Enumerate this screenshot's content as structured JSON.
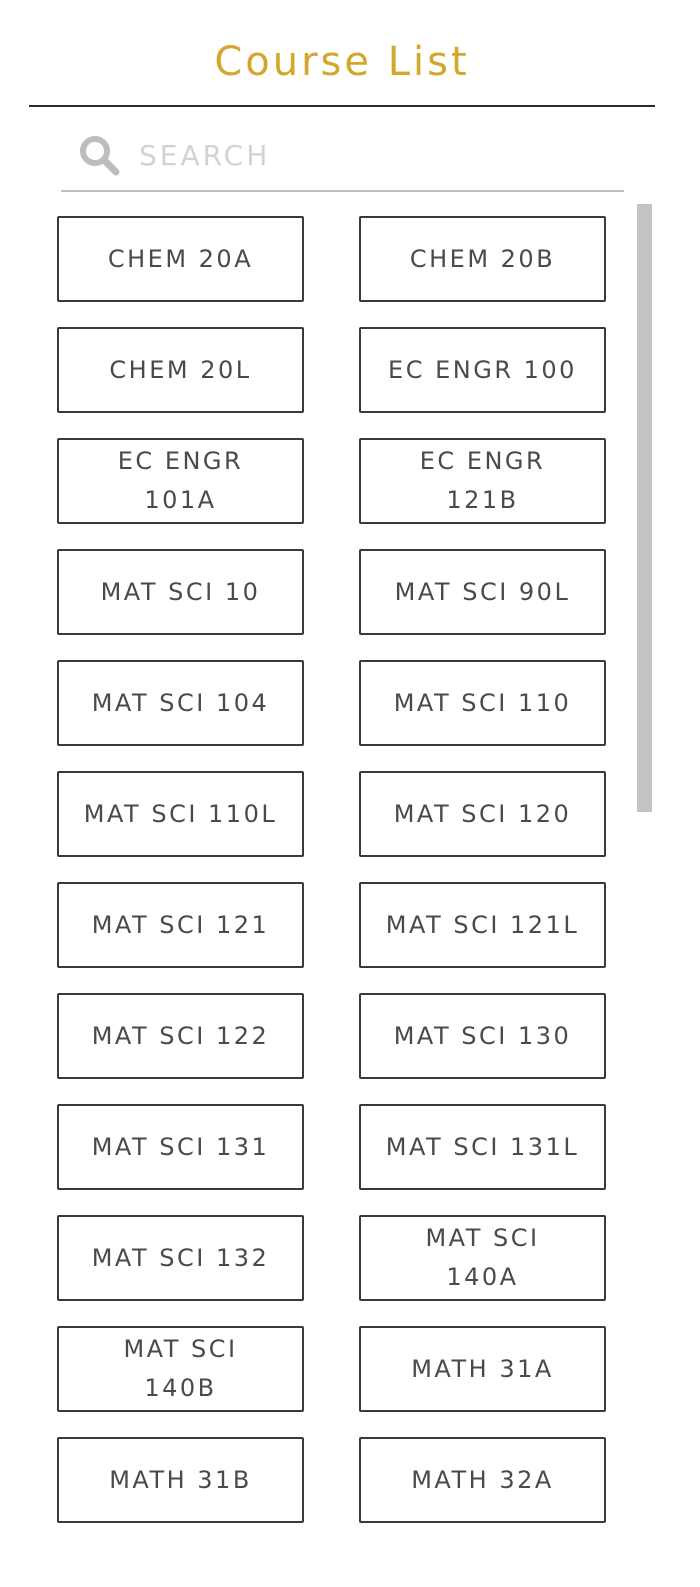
{
  "header": {
    "title": "Course List",
    "title_color": "#d4a72c"
  },
  "search": {
    "placeholder": "SEARCH",
    "value": "",
    "icon": "search-icon"
  },
  "courses": [
    "CHEM 20A",
    "CHEM 20B",
    "CHEM 20L",
    "EC ENGR 100",
    "EC ENGR 101A",
    "EC ENGR 121B",
    "MAT SCI 10",
    "MAT SCI 90L",
    "MAT SCI 104",
    "MAT SCI 110",
    "MAT SCI 110L",
    "MAT SCI 120",
    "MAT SCI 121",
    "MAT SCI 121L",
    "MAT SCI 122",
    "MAT SCI 130",
    "MAT SCI 131",
    "MAT SCI 131L",
    "MAT SCI 132",
    "MAT SCI 140A",
    "MAT SCI 140B",
    "MATH 31A",
    "MATH 31B",
    "MATH 32A"
  ]
}
